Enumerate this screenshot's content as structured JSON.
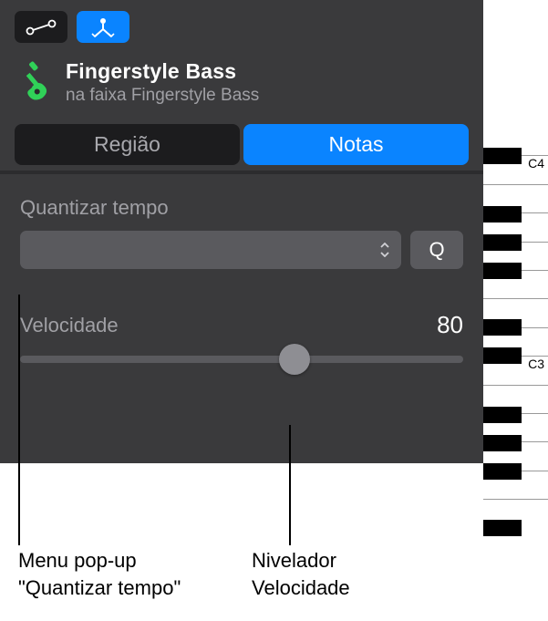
{
  "toolbar": {
    "automation_icon": "automation-curve-icon",
    "flex_icon": "flex-icon"
  },
  "header": {
    "title": "Fingerstyle Bass",
    "subtitle": "na faixa Fingerstyle Bass"
  },
  "tabs": {
    "region": "Região",
    "notes": "Notas"
  },
  "quantize": {
    "label": "Quantizar tempo",
    "selected": "",
    "q_button": "Q"
  },
  "velocity": {
    "label": "Velocidade",
    "value": "80",
    "slider_percent": 62
  },
  "piano": {
    "label_c4": "C4",
    "label_c3": "C3"
  },
  "callouts": {
    "left_line1": "Menu pop-up",
    "left_line2": "\"Quantizar tempo\"",
    "right_line1": "Nivelador",
    "right_line2": "Velocidade"
  }
}
